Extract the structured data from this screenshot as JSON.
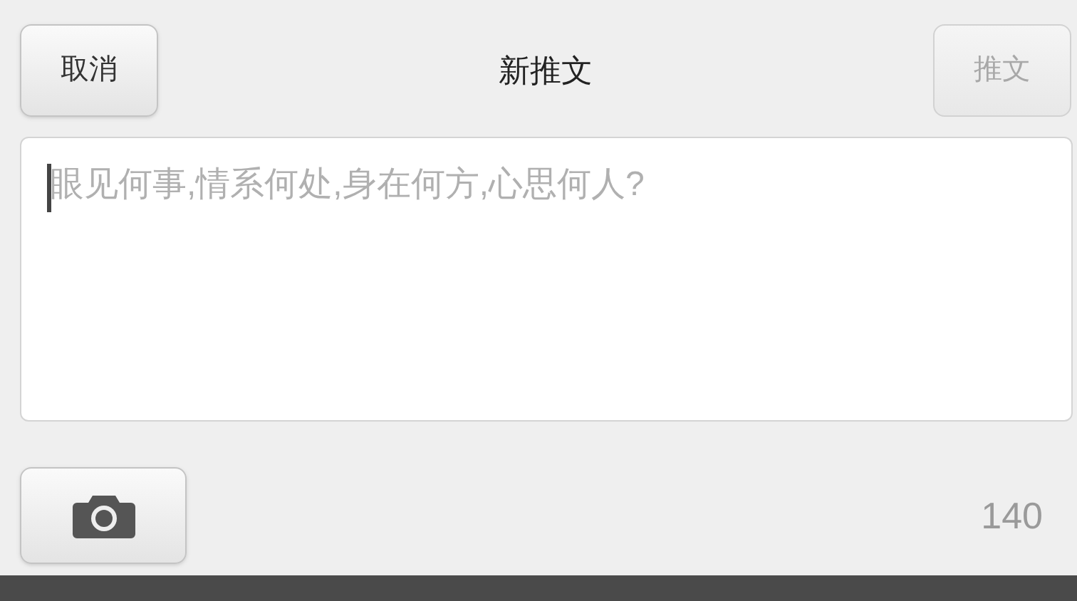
{
  "header": {
    "cancel": "取消",
    "title": "新推文",
    "tweet": {
      "label": "推文",
      "disabled": true
    }
  },
  "compose": {
    "placeholder": "眼见何事,情系何处,身在何方,心思何人?"
  },
  "footer": {
    "counter": "140"
  }
}
